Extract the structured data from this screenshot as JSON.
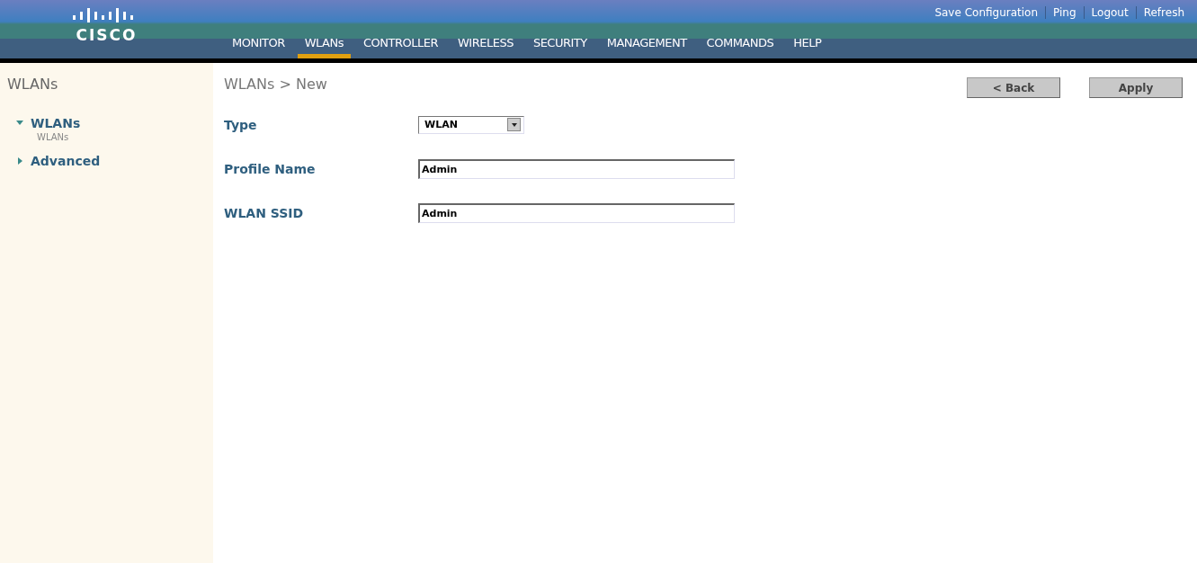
{
  "header": {
    "logo_text": "CISCO",
    "top_links": [
      "Save Configuration",
      "Ping",
      "Logout",
      "Refresh"
    ],
    "nav": [
      {
        "label": "MONITOR",
        "selected": false
      },
      {
        "label": "WLANs",
        "selected": true
      },
      {
        "label": "CONTROLLER",
        "selected": false
      },
      {
        "label": "WIRELESS",
        "selected": false
      },
      {
        "label": "SECURITY",
        "selected": false
      },
      {
        "label": "MANAGEMENT",
        "selected": false
      },
      {
        "label": "COMMANDS",
        "selected": false
      },
      {
        "label": "HELP",
        "selected": false
      }
    ]
  },
  "sidebar": {
    "title": "WLANs",
    "items": [
      {
        "label": "WLANs",
        "expanded": true,
        "children": [
          {
            "label": "WLANs"
          }
        ]
      },
      {
        "label": "Advanced",
        "expanded": false
      }
    ]
  },
  "page": {
    "title": "WLANs > New",
    "buttons": [
      "< Back",
      "Apply"
    ],
    "fields": [
      {
        "kind": "select",
        "label": "Type",
        "value": "WLAN"
      },
      {
        "kind": "text",
        "label": "Profile Name",
        "value": "Admin"
      },
      {
        "kind": "text",
        "label": "WLAN SSID",
        "value": "Admin"
      }
    ]
  }
}
